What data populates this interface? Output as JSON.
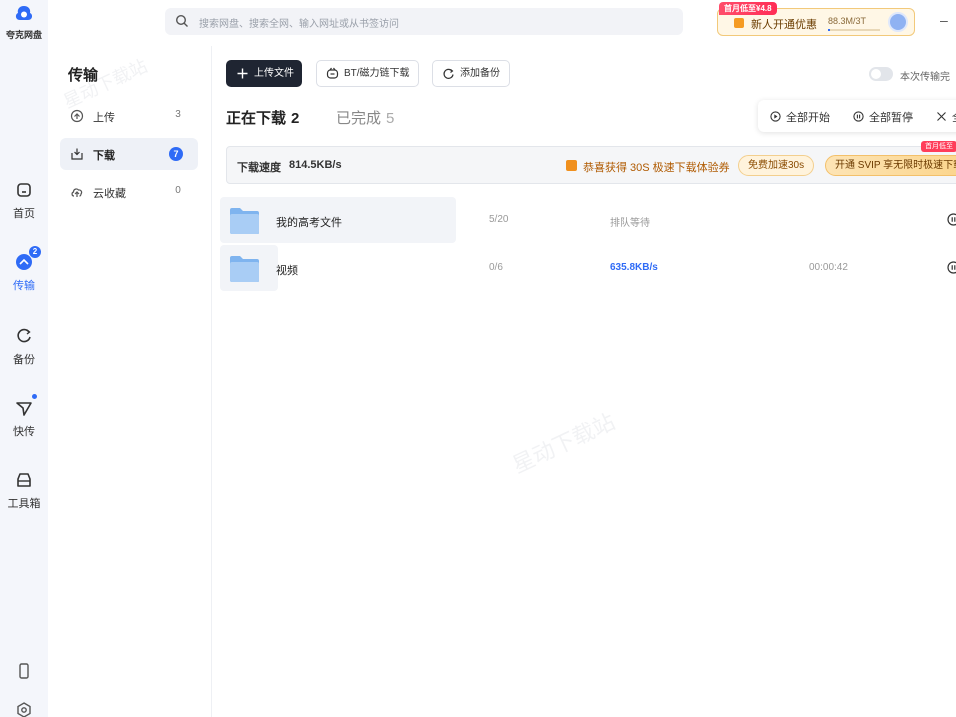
{
  "app": {
    "logo_text": "夸克网盘"
  },
  "rail": {
    "items": [
      {
        "id": "home",
        "label": "首页",
        "icon": "home-icon"
      },
      {
        "id": "transfer",
        "label": "传输",
        "icon": "transfer-icon",
        "badge": "2",
        "active": true
      },
      {
        "id": "backup",
        "label": "备份",
        "icon": "backup-icon"
      },
      {
        "id": "quick",
        "label": "快传",
        "icon": "quick-send-icon",
        "dot": true
      },
      {
        "id": "tools",
        "label": "工具箱",
        "icon": "toolbox-icon"
      }
    ],
    "bottom_icons": [
      "phone-icon",
      "settings-icon"
    ]
  },
  "topbar": {
    "search_placeholder": "搜索网盘、搜索全网、输入网址或从书签访问",
    "promo": {
      "tag": "首月低至¥4.8",
      "text": "新人开通优惠",
      "capacity": "88.3M/3T",
      "capacity_fraction": 0.03
    },
    "minimize": "–"
  },
  "sidebar": {
    "title": "传输",
    "items": [
      {
        "label": "上传",
        "count": "3",
        "icon": "upload-icon"
      },
      {
        "label": "下载",
        "count": "7",
        "icon": "download-icon",
        "active": true
      },
      {
        "label": "云收藏",
        "count": "0",
        "icon": "cloud-favorite-icon"
      }
    ]
  },
  "toolbar": {
    "upload_label": "上传文件",
    "bt_label": "BT/磁力链下载",
    "backup_label": "添加备份",
    "toggle_label": "本次传输完"
  },
  "tabs": {
    "downloading_label": "正在下载",
    "downloading_count": "2",
    "completed_label": "已完成",
    "completed_count": "5"
  },
  "controls": {
    "start_all": "全部开始",
    "pause_all": "全部暂停",
    "close_label": "全"
  },
  "speed_bar": {
    "label": "下载速度",
    "value": "814.5KB/s",
    "message": "恭喜获得 30S 极速下载体验券",
    "free_button": "免费加速30s",
    "svip_button": "开通 SVIP 享无限时极速下载",
    "svip_tag": "首月低至"
  },
  "downloads": [
    {
      "name": "我的高考文件",
      "progress": "5/20",
      "status": "排队等待",
      "eta": ""
    },
    {
      "name": "视频",
      "progress": "0/6",
      "status": "635.8KB/s",
      "eta": "00:00:42"
    }
  ],
  "watermark": "星动下载站",
  "colors": {
    "accent": "#2f6bf6",
    "dark_button": "#1f2532",
    "promo_orange": "#f0901e"
  }
}
